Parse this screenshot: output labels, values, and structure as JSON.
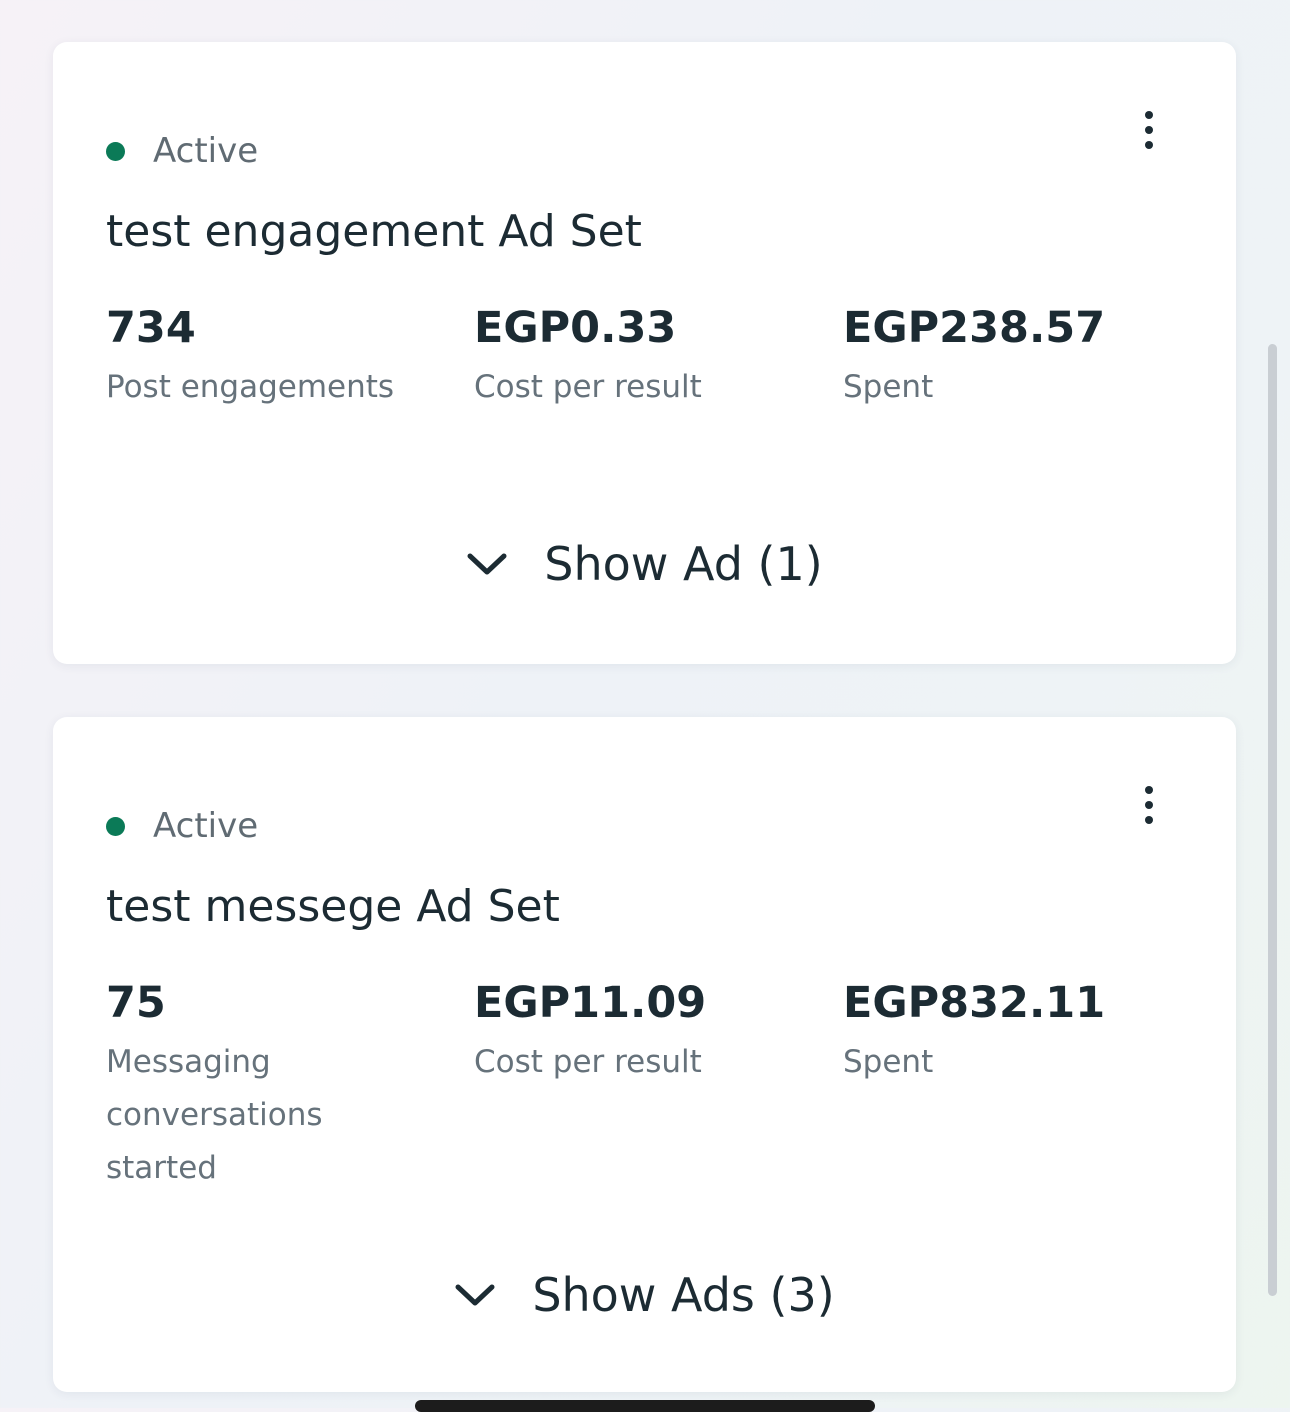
{
  "ad_sets": [
    {
      "status": "Active",
      "name": "test engagement Ad Set",
      "metrics": [
        {
          "value": "734",
          "label": "Post engagements"
        },
        {
          "value": "EGP0.33",
          "label": "Cost per result"
        },
        {
          "value": "EGP238.57",
          "label": "Spent"
        }
      ],
      "show_ads_label": "Show Ad (1)"
    },
    {
      "status": "Active",
      "name": "test messege Ad Set",
      "metrics": [
        {
          "value": "75",
          "label": "Messaging conversations started"
        },
        {
          "value": "EGP11.09",
          "label": "Cost per result"
        },
        {
          "value": "EGP832.11",
          "label": "Spent"
        }
      ],
      "show_ads_label": "Show Ads (3)"
    }
  ],
  "icons": {
    "status": "status-dot-icon",
    "more": "more-options-icon",
    "expand": "chevron-down-icon"
  },
  "colors": {
    "active_status": "#0b7a57",
    "text_primary": "#1c2b33",
    "text_secondary": "#66727b"
  }
}
